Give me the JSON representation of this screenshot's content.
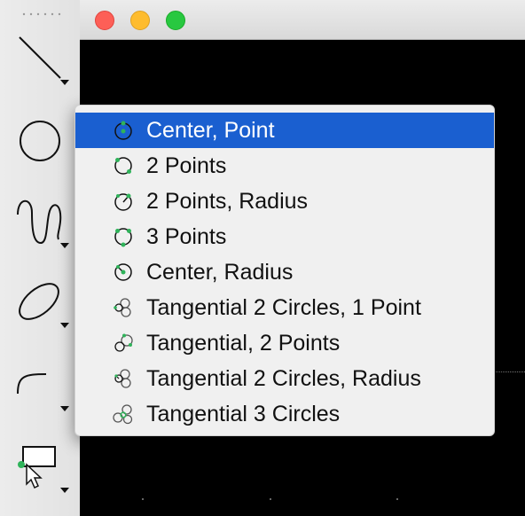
{
  "toolbar": {
    "tools": [
      {
        "name": "line-tool",
        "icon": "line-icon"
      },
      {
        "name": "circle-tool",
        "icon": "circle-icon"
      },
      {
        "name": "spline-tool",
        "icon": "spline-icon"
      },
      {
        "name": "ellipse-tool",
        "icon": "ellipse-icon"
      },
      {
        "name": "arc-tool",
        "icon": "arc-icon"
      },
      {
        "name": "select-tool",
        "icon": "selection-icon"
      }
    ]
  },
  "window": {
    "controls": [
      "close",
      "minimize",
      "maximize"
    ],
    "colors": {
      "close": "#fd5f57",
      "minimize": "#febc2e",
      "maximize": "#28c840"
    }
  },
  "menu": {
    "selected_index": 0,
    "accent": "#1a5fd0",
    "icon_accent": "#2fb35a",
    "items": [
      {
        "label": "Center, Point",
        "icon": "circle-center-point-icon"
      },
      {
        "label": "2 Points",
        "icon": "circle-2-points-icon"
      },
      {
        "label": "2 Points, Radius",
        "icon": "circle-2-points-radius-icon"
      },
      {
        "label": "3 Points",
        "icon": "circle-3-points-icon"
      },
      {
        "label": "Center, Radius",
        "icon": "circle-center-radius-icon"
      },
      {
        "label": "Tangential 2 Circles, 1 Point",
        "icon": "tangential-2-circles-point-icon"
      },
      {
        "label": "Tangential, 2 Points",
        "icon": "tangential-2-points-icon"
      },
      {
        "label": "Tangential 2 Circles, Radius",
        "icon": "tangential-2-circles-radius-icon"
      },
      {
        "label": "Tangential 3 Circles",
        "icon": "tangential-3-circles-icon"
      }
    ]
  }
}
